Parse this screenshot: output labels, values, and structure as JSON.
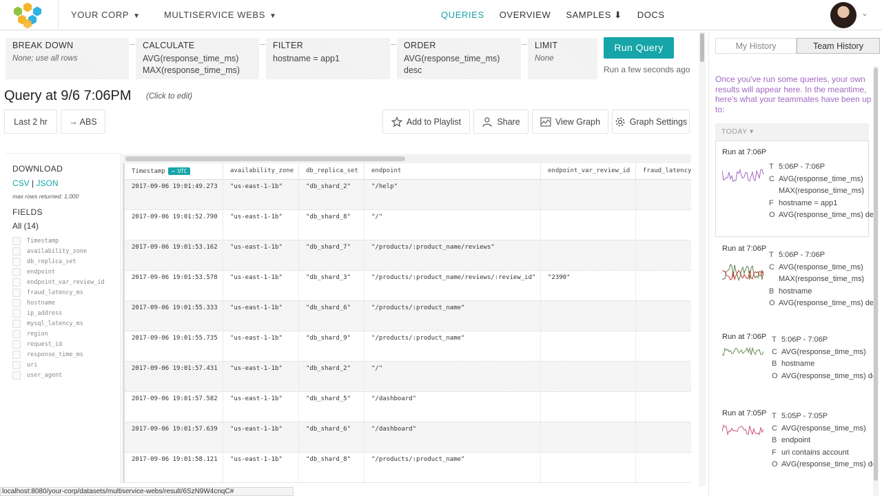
{
  "nav": {
    "team": "YOUR CORP",
    "dataset": "MULTISERVICE WEBS",
    "links": [
      "QUERIES",
      "OVERVIEW",
      "SAMPLES",
      "DOCS"
    ],
    "active_link": "QUERIES",
    "samples_icon": "download-arrow-icon",
    "accent_color": "#16a5a8"
  },
  "builder": {
    "breakdown": {
      "label": "BREAK DOWN",
      "value": "None; use all rows"
    },
    "calculate": {
      "label": "CALCULATE",
      "values": [
        "AVG(response_time_ms)",
        "MAX(response_time_ms)"
      ]
    },
    "filter": {
      "label": "FILTER",
      "value": "hostname = app1"
    },
    "order": {
      "label": "ORDER",
      "values": [
        "AVG(response_time_ms)",
        "desc"
      ]
    },
    "limit": {
      "label": "LIMIT",
      "value": "None"
    },
    "run_label": "Run Query",
    "run_status": "Run a few seconds ago"
  },
  "query": {
    "title": "Query at 9/6 7:06PM",
    "hint": "(Click to edit)",
    "time_range": "Last 2 hr",
    "abs_label": "→ ABS",
    "add_playlist": "Add to Playlist",
    "share": "Share",
    "view_graph": "View Graph",
    "graph_settings": "Graph Settings"
  },
  "sidebar": {
    "download_label": "DOWNLOAD",
    "csv": "CSV",
    "sep": "|",
    "json": "JSON",
    "max_rows": "max rows returned: 1,000",
    "fields_label": "FIELDS",
    "all_label": "All (14)",
    "fields": [
      "Timestamp",
      "availability_zone",
      "db_replica_set",
      "endpoint",
      "endpoint_var_review_id",
      "fraud_latency_ms",
      "hostname",
      "ip_address",
      "mysql_latency_ms",
      "region",
      "request_id",
      "response_time_ms",
      "uri",
      "user_agent"
    ]
  },
  "table": {
    "columns": [
      "Timestamp",
      "availability_zone",
      "db_replica_set",
      "endpoint",
      "endpoint_var_review_id",
      "fraud_latency_"
    ],
    "utc_badge": "→ UTC",
    "rows": [
      [
        "2017-09-06 19:01:49.273",
        "\"us-east-1-1b\"",
        "\"db_shard_2\"",
        "\"/help\"",
        "",
        ""
      ],
      [
        "2017-09-06 19:01:52.790",
        "\"us-east-1-1b\"",
        "\"db_shard_8\"",
        "\"/\"",
        "",
        ""
      ],
      [
        "2017-09-06 19:01:53.162",
        "\"us-east-1-1b\"",
        "\"db_shard_7\"",
        "\"/products/:product_name/reviews\"",
        "",
        ""
      ],
      [
        "2017-09-06 19:01:53.578",
        "\"us-east-1-1b\"",
        "\"db_shard_3\"",
        "\"/products/:product_name/reviews/:review_id\"",
        "\"2390\"",
        ""
      ],
      [
        "2017-09-06 19:01:55.333",
        "\"us-east-1-1b\"",
        "\"db_shard_6\"",
        "\"/products/:product_name\"",
        "",
        ""
      ],
      [
        "2017-09-06 19:01:55.735",
        "\"us-east-1-1b\"",
        "\"db_shard_9\"",
        "\"/products/:product_name\"",
        "",
        ""
      ],
      [
        "2017-09-06 19:01:57.431",
        "\"us-east-1-1b\"",
        "\"db_shard_2\"",
        "\"/\"",
        "",
        ""
      ],
      [
        "2017-09-06 19:01:57.582",
        "\"us-east-1-1b\"",
        "\"db_shard_5\"",
        "\"/dashboard\"",
        "",
        ""
      ],
      [
        "2017-09-06 19:01:57.639",
        "\"us-east-1-1b\"",
        "\"db_shard_6\"",
        "\"/dashboard\"",
        "",
        ""
      ],
      [
        "2017-09-06 19:01:58.121",
        "\"us-east-1-1b\"",
        "\"db_shard_8\"",
        "\"/products/:product_name\"",
        "",
        ""
      ]
    ]
  },
  "history": {
    "tabs": [
      "My History",
      "Team History"
    ],
    "active_tab": "Team History",
    "intro": "Once you've run some queries, your own results will appear here. In the meantime, here's what your teammates have been up to:",
    "today_label": "TODAY",
    "items": [
      {
        "run_at": "Run at 7:06P",
        "lines": [
          [
            "T",
            "5:06P - 7:06P"
          ],
          [
            "C",
            "AVG(response_time_ms)"
          ],
          [
            "",
            "MAX(response_time_ms)"
          ],
          [
            "F",
            "hostname = app1"
          ],
          [
            "O",
            "AVG(response_time_ms) de"
          ]
        ],
        "spark_color": "#a268c3"
      },
      {
        "run_at": "Run at 7:06P",
        "lines": [
          [
            "T",
            "5:06P - 7:06P"
          ],
          [
            "C",
            "AVG(response_time_ms)"
          ],
          [
            "",
            "MAX(response_time_ms)"
          ],
          [
            "B",
            "hostname"
          ],
          [
            "O",
            "AVG(response_time_ms) de"
          ]
        ],
        "spark_color": "#5b7e4e"
      },
      {
        "run_at": "Run at 7:06P",
        "lines": [
          [
            "T",
            "5:06P - 7:06P"
          ],
          [
            "C",
            "AVG(response_time_ms)"
          ],
          [
            "B",
            "hostname"
          ],
          [
            "O",
            "AVG(response_time_ms) de"
          ]
        ],
        "spark_color": "#6a8a5a"
      },
      {
        "run_at": "Run at 7:05P",
        "lines": [
          [
            "T",
            "5:05P - 7:05P"
          ],
          [
            "C",
            "AVG(response_time_ms)"
          ],
          [
            "B",
            "endpoint"
          ],
          [
            "F",
            "uri contains account"
          ],
          [
            "O",
            "AVG(response_time_ms) de"
          ]
        ],
        "spark_color": "#c9557a"
      }
    ]
  },
  "statusbar": "localhost:8080/your-corp/datasets/multiservice-webs/result/6SzN9W4cnqC#"
}
